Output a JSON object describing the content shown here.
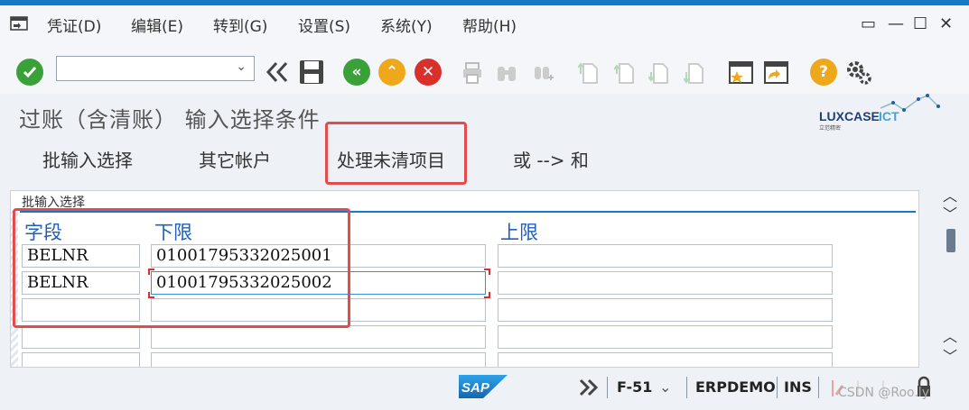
{
  "menu": {
    "items": [
      "凭证(D)",
      "编辑(E)",
      "转到(G)",
      "设置(S)",
      "系统(Y)",
      "帮助(H)"
    ],
    "window_controls": {
      "restore": "▭",
      "minimize": "—",
      "maximize": "☐",
      "close": "✕"
    }
  },
  "toolbar": {
    "command_field": {
      "value": "",
      "placeholder": ""
    },
    "back_label": "«",
    "exit_label": "⌃",
    "cancel_label": "✕",
    "help_label": "?"
  },
  "title": {
    "text": "过账（含清账） 输入选择条件",
    "logo_text": "LUXCASE",
    "logo_accent": "ICT",
    "logo_sub": "立范精密"
  },
  "app_toolbar": {
    "buttons": [
      "批输入选择",
      "其它帐户",
      "处理未清项目",
      "或 --> 和"
    ]
  },
  "selection": {
    "group_title": "批输入选择",
    "headers": {
      "field": "字段",
      "lower": "下限",
      "upper": "上限"
    },
    "rows": [
      {
        "field": "BELNR",
        "lower": "01001795332025001",
        "upper": ""
      },
      {
        "field": "BELNR",
        "lower": "01001795332025002",
        "upper": ""
      },
      {
        "field": "",
        "lower": "",
        "upper": ""
      },
      {
        "field": "",
        "lower": "",
        "upper": ""
      },
      {
        "field": "",
        "lower": "",
        "upper": ""
      }
    ]
  },
  "status": {
    "sap_logo": "SAP",
    "transaction": "F-51",
    "system": "ERPDEMO",
    "mode": "INS",
    "watermark": "CSDN @Roo.ly"
  },
  "colors": {
    "accent": "#1679c5",
    "highlight": "#e24c4c",
    "header_text": "#1f5fbf"
  }
}
